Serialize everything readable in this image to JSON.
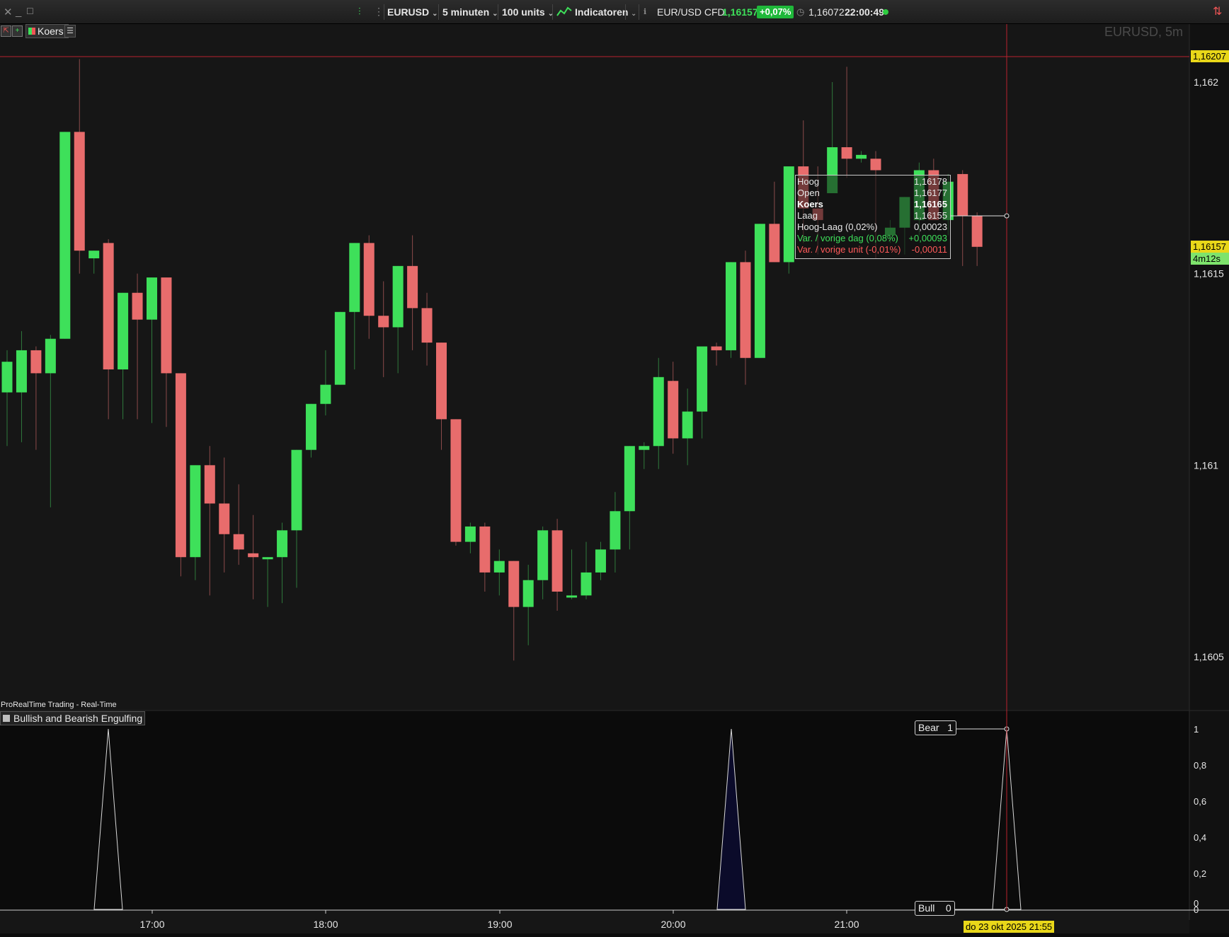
{
  "toolbar": {
    "symbol": "EURUSD",
    "timeframe": "5 minuten",
    "units": "100 units",
    "indicators_label": "Indicatoren",
    "instrument": "EUR/USD CFD",
    "last_price": "1,16157",
    "change_pct": "+0,07%",
    "ref_price": "1,16072",
    "time": "22:00:49",
    "colors": {
      "up": "#3ee05a",
      "down": "#e86c6c",
      "badge": "#1fb83a"
    }
  },
  "subbar": {
    "tab_label": "Koers"
  },
  "chart": {
    "watermark": "EURUSD, 5m",
    "y_ticks": [
      "1,162",
      "1,1615",
      "1,161",
      "1,1605"
    ],
    "x_ticks": [
      "17:00",
      "18:00",
      "19:00",
      "20:00",
      "21:00"
    ],
    "price_line_label": "1,16207",
    "current_price_label": "1,16157",
    "countdown_label": "4m12s",
    "date_label": "do 23 okt 2025 21:55"
  },
  "tooltip": {
    "rows": [
      {
        "key": "Hoog",
        "value": "1,16178"
      },
      {
        "key": "Open",
        "value": "1,16177"
      },
      {
        "key": "Koers",
        "value": "1,16165"
      },
      {
        "key": "Laag",
        "value": "1,16155"
      },
      {
        "key": "Hoog-Laag (0,02%)",
        "value": "0,00023"
      },
      {
        "key": "Var. / vorige dag (0,08%)",
        "value": "+0,00093"
      },
      {
        "key": "Var. / vorige unit (-0,01%)",
        "value": "-0,00011"
      }
    ]
  },
  "indicator": {
    "feed_label": "ProRealTime Trading - Real-Time",
    "title": "Bullish and Bearish Engulfing",
    "bear_label": "Bear",
    "bear_value": "1",
    "bull_label": "Bull",
    "bull_value": "0",
    "y_ticks": [
      "1",
      "0,8",
      "0,6",
      "0,4",
      "0,2",
      "0",
      "0"
    ]
  },
  "chart_data": {
    "type": "candlestick",
    "timeframe": "5m",
    "symbol": "EURUSD",
    "ylim": [
      1.16016,
      1.16226
    ],
    "candles": [
      {
        "o": 1.16119,
        "h": 1.1613,
        "l": 1.16105,
        "c": 1.16127
      },
      {
        "o": 1.16119,
        "h": 1.16135,
        "l": 1.16106,
        "c": 1.1613
      },
      {
        "o": 1.1613,
        "h": 1.16131,
        "l": 1.16104,
        "c": 1.16124
      },
      {
        "o": 1.16124,
        "h": 1.16134,
        "l": 1.16089,
        "c": 1.16133
      },
      {
        "o": 1.16133,
        "h": 1.16172,
        "l": 1.16133,
        "c": 1.16187
      },
      {
        "o": 1.16187,
        "h": 1.16206,
        "l": 1.1615,
        "c": 1.16156
      },
      {
        "o": 1.16154,
        "h": 1.16156,
        "l": 1.1615,
        "c": 1.16156
      },
      {
        "o": 1.16158,
        "h": 1.16159,
        "l": 1.16112,
        "c": 1.16125
      },
      {
        "o": 1.16125,
        "h": 1.16144,
        "l": 1.16112,
        "c": 1.16145
      },
      {
        "o": 1.16145,
        "h": 1.1615,
        "l": 1.16112,
        "c": 1.16138
      },
      {
        "o": 1.16138,
        "h": 1.16144,
        "l": 1.16111,
        "c": 1.16149
      },
      {
        "o": 1.16149,
        "h": 1.16149,
        "l": 1.1611,
        "c": 1.16124
      },
      {
        "o": 1.16124,
        "h": 1.16124,
        "l": 1.16071,
        "c": 1.16076
      },
      {
        "o": 1.16076,
        "h": 1.16083,
        "l": 1.1607,
        "c": 1.161
      },
      {
        "o": 1.161,
        "h": 1.16105,
        "l": 1.16066,
        "c": 1.1609
      },
      {
        "o": 1.1609,
        "h": 1.16102,
        "l": 1.16072,
        "c": 1.16082
      },
      {
        "o": 1.16082,
        "h": 1.16095,
        "l": 1.16074,
        "c": 1.16078
      },
      {
        "o": 1.16077,
        "h": 1.16087,
        "l": 1.16065,
        "c": 1.16076
      },
      {
        "o": 1.16076,
        "h": 1.16076,
        "l": 1.16063,
        "c": 1.16076
      },
      {
        "o": 1.16076,
        "h": 1.16085,
        "l": 1.16064,
        "c": 1.16083
      },
      {
        "o": 1.16083,
        "h": 1.16084,
        "l": 1.16068,
        "c": 1.16104
      },
      {
        "o": 1.16104,
        "h": 1.16114,
        "l": 1.16102,
        "c": 1.16116
      },
      {
        "o": 1.16116,
        "h": 1.1613,
        "l": 1.16113,
        "c": 1.16121
      },
      {
        "o": 1.16121,
        "h": 1.16139,
        "l": 1.16121,
        "c": 1.1614
      },
      {
        "o": 1.1614,
        "h": 1.1615,
        "l": 1.16125,
        "c": 1.16158
      },
      {
        "o": 1.16158,
        "h": 1.1616,
        "l": 1.16133,
        "c": 1.16139
      },
      {
        "o": 1.16139,
        "h": 1.16148,
        "l": 1.16123,
        "c": 1.16136
      },
      {
        "o": 1.16136,
        "h": 1.16145,
        "l": 1.16124,
        "c": 1.16152
      },
      {
        "o": 1.16152,
        "h": 1.1616,
        "l": 1.1613,
        "c": 1.16141
      },
      {
        "o": 1.16141,
        "h": 1.16145,
        "l": 1.16126,
        "c": 1.16132
      },
      {
        "o": 1.16132,
        "h": 1.16132,
        "l": 1.16104,
        "c": 1.16112
      },
      {
        "o": 1.16112,
        "h": 1.16112,
        "l": 1.16079,
        "c": 1.1608
      },
      {
        "o": 1.1608,
        "h": 1.16085,
        "l": 1.16077,
        "c": 1.16084
      },
      {
        "o": 1.16084,
        "h": 1.16085,
        "l": 1.16067,
        "c": 1.16072
      },
      {
        "o": 1.16072,
        "h": 1.16078,
        "l": 1.16066,
        "c": 1.16075
      },
      {
        "o": 1.16075,
        "h": 1.16075,
        "l": 1.16049,
        "c": 1.16063
      },
      {
        "o": 1.16063,
        "h": 1.16074,
        "l": 1.16053,
        "c": 1.1607
      },
      {
        "o": 1.1607,
        "h": 1.16084,
        "l": 1.16065,
        "c": 1.16083
      },
      {
        "o": 1.16083,
        "h": 1.16086,
        "l": 1.16062,
        "c": 1.16067
      },
      {
        "o": 1.16066,
        "h": 1.16078,
        "l": 1.16065,
        "c": 1.16066
      },
      {
        "o": 1.16066,
        "h": 1.1608,
        "l": 1.16065,
        "c": 1.16072
      },
      {
        "o": 1.16072,
        "h": 1.1608,
        "l": 1.1607,
        "c": 1.16078
      },
      {
        "o": 1.16078,
        "h": 1.16093,
        "l": 1.16072,
        "c": 1.16088
      },
      {
        "o": 1.16088,
        "h": 1.16104,
        "l": 1.16078,
        "c": 1.16105
      },
      {
        "o": 1.16104,
        "h": 1.16106,
        "l": 1.16099,
        "c": 1.16105
      },
      {
        "o": 1.16105,
        "h": 1.16128,
        "l": 1.16099,
        "c": 1.16123
      },
      {
        "o": 1.16122,
        "h": 1.16127,
        "l": 1.16103,
        "c": 1.16107
      },
      {
        "o": 1.16107,
        "h": 1.1612,
        "l": 1.161,
        "c": 1.16114
      },
      {
        "o": 1.16114,
        "h": 1.16131,
        "l": 1.16107,
        "c": 1.16131
      },
      {
        "o": 1.16131,
        "h": 1.16132,
        "l": 1.16126,
        "c": 1.1613
      },
      {
        "o": 1.1613,
        "h": 1.16145,
        "l": 1.16128,
        "c": 1.16153
      },
      {
        "o": 1.16153,
        "h": 1.16156,
        "l": 1.16121,
        "c": 1.16128
      },
      {
        "o": 1.16128,
        "h": 1.16148,
        "l": 1.16128,
        "c": 1.16163
      },
      {
        "o": 1.16163,
        "h": 1.16174,
        "l": 1.16153,
        "c": 1.16153
      },
      {
        "o": 1.16153,
        "h": 1.16165,
        "l": 1.1615,
        "c": 1.16178
      },
      {
        "o": 1.16178,
        "h": 1.1619,
        "l": 1.16158,
        "c": 1.16167
      },
      {
        "o": 1.16167,
        "h": 1.16178,
        "l": 1.16155,
        "c": 1.16164
      },
      {
        "o": 1.16171,
        "h": 1.162,
        "l": 1.16171,
        "c": 1.16183
      },
      {
        "o": 1.16183,
        "h": 1.16204,
        "l": 1.16175,
        "c": 1.1618
      },
      {
        "o": 1.1618,
        "h": 1.16182,
        "l": 1.16179,
        "c": 1.16181
      },
      {
        "o": 1.1618,
        "h": 1.16182,
        "l": 1.16154,
        "c": 1.16177
      },
      {
        "o": 1.1616,
        "h": 1.16164,
        "l": 1.16158,
        "c": 1.16162
      },
      {
        "o": 1.16162,
        "h": 1.1617,
        "l": 1.16155,
        "c": 1.1617
      },
      {
        "o": 1.16164,
        "h": 1.16179,
        "l": 1.1616,
        "c": 1.16177
      },
      {
        "o": 1.16177,
        "h": 1.1618,
        "l": 1.16164,
        "c": 1.16164
      },
      {
        "o": 1.16164,
        "h": 1.16176,
        "l": 1.1616,
        "c": 1.16174
      },
      {
        "o": 1.16176,
        "h": 1.16177,
        "l": 1.16152,
        "c": 1.16165
      },
      {
        "o": 1.16165,
        "h": 1.16166,
        "l": 1.16152,
        "c": 1.16157
      }
    ],
    "indicator": {
      "name": "Bullish and Bearish Engulfing",
      "ylim": [
        0,
        1
      ],
      "spikes_at_candle": [
        7,
        50,
        66
      ],
      "values": "1 at spike candles, 0 otherwise"
    }
  }
}
